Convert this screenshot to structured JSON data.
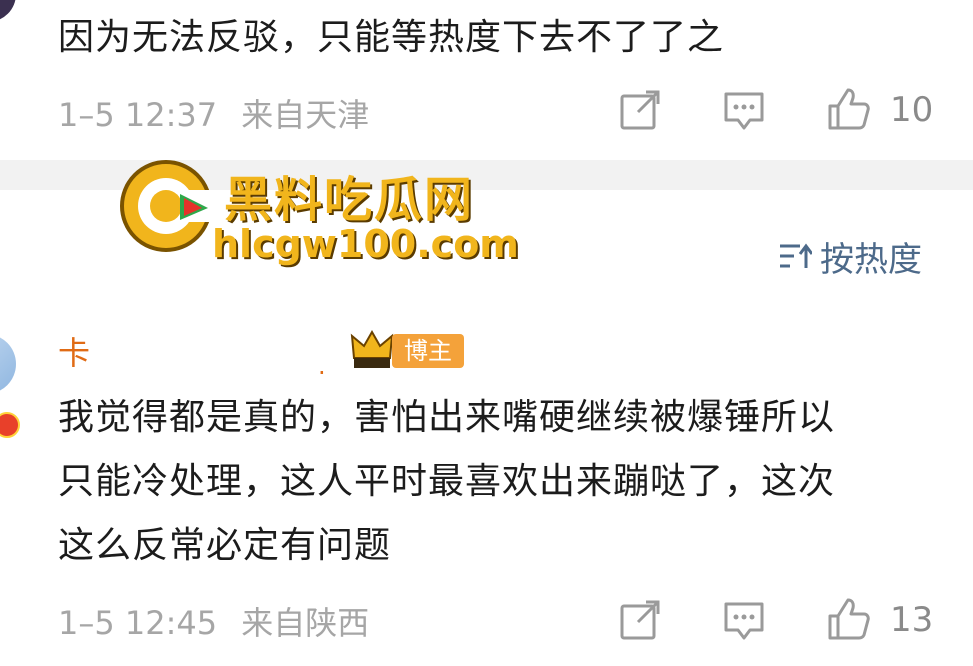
{
  "comments": [
    {
      "text": "因为无法反驳，只能等热度下去不了了之",
      "timestamp": "1–5 12:37",
      "location": "来自天津",
      "likes": "10"
    },
    {
      "username": "卡",
      "author_badge": "博主",
      "text_lines": [
        "我觉得都是真的，害怕出来嘴硬继续被爆锤所以",
        "只能冷处理，这人平时最喜欢出来蹦哒了，这次",
        "这么反常必定有问题"
      ],
      "timestamp": "1–5 12:45",
      "location": "来自陕西",
      "likes": "13"
    }
  ],
  "sort": {
    "label": "按热度"
  },
  "watermark": {
    "title": "黑料吃瓜网",
    "url": "hlcgw100.com"
  },
  "colors": {
    "username": "#e06b15",
    "badge_bg": "#f4a23a",
    "link": "#4d6a8a",
    "meta": "#a6a6a6",
    "watermark": "#f1b51c"
  },
  "icons": [
    "share-icon",
    "comment-icon",
    "like-icon",
    "sort-icon",
    "crown-icon"
  ]
}
